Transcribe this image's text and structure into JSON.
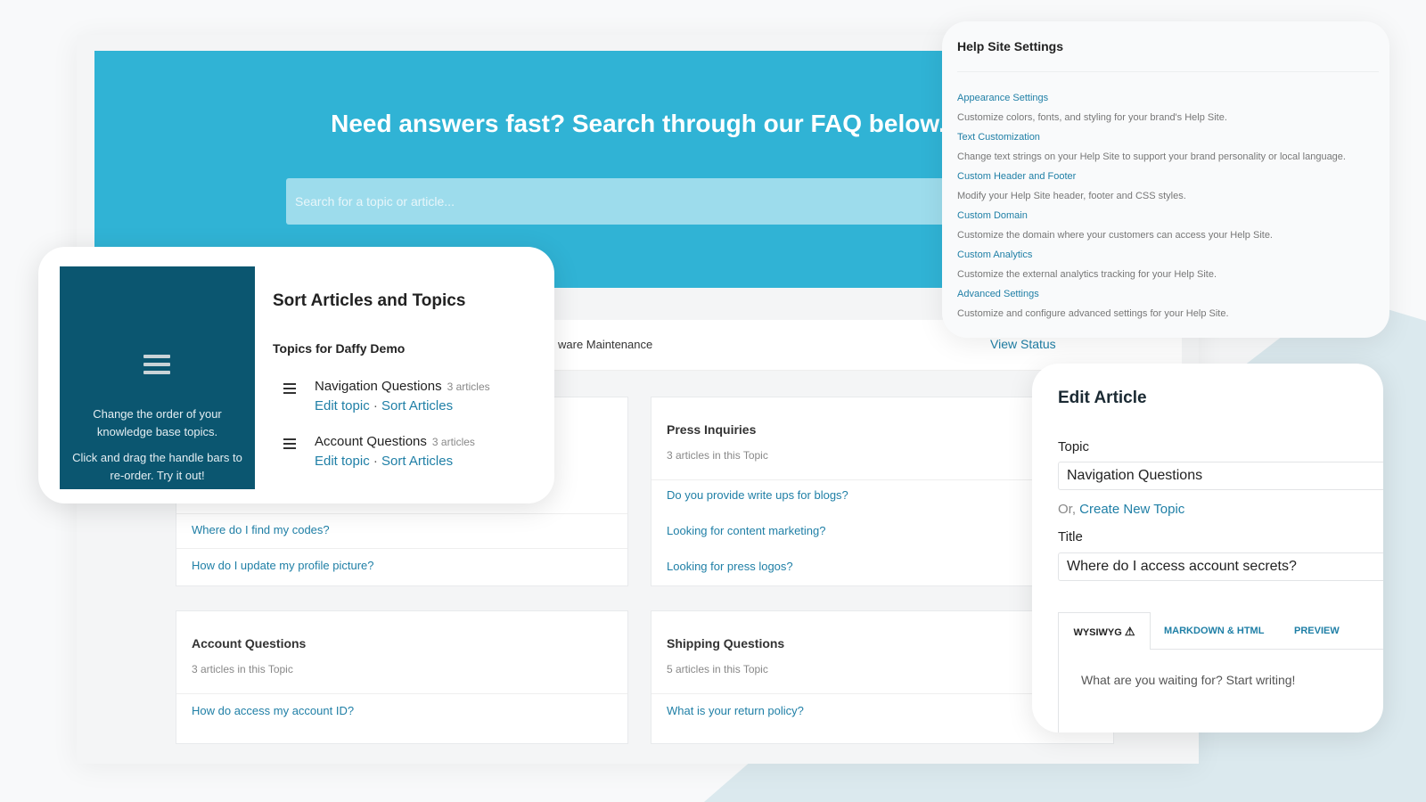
{
  "banner": {
    "heading": "Need answers fast? Search through our FAQ below.",
    "search_placeholder": "Search for a topic or article..."
  },
  "status_bar": {
    "text": "ware Maintenance",
    "link": "View Status"
  },
  "cards": [
    {
      "title": "",
      "count": "",
      "links": [
        "Where do I find my codes?",
        "How do I update my profile picture?"
      ]
    },
    {
      "title": "Press Inquiries",
      "count": "3 articles in this Topic",
      "links": [
        "Do you provide write ups for blogs?",
        "Looking for content marketing?",
        "Looking for press logos?"
      ]
    },
    {
      "title": "Account Questions",
      "count": "3 articles in this Topic",
      "links": [
        "How do access my account ID?"
      ]
    },
    {
      "title": "Shipping Questions",
      "count": "5 articles in this Topic",
      "links": [
        "What is your return policy?"
      ]
    }
  ],
  "sort_panel": {
    "tip1": "Change the order of your knowledge base topics.",
    "tip2": "Click and drag the handle bars to re-order. Try it out!",
    "title": "Sort Articles and Topics",
    "subtitle": "Topics for Daffy Demo",
    "topics": [
      {
        "name": "Navigation Questions",
        "count": "3 articles",
        "edit": "Edit topic",
        "sep": " · ",
        "sort": "Sort Articles"
      },
      {
        "name": "Account Questions",
        "count": "3 articles",
        "edit": "Edit topic",
        "sep": " · ",
        "sort": "Sort Articles"
      }
    ]
  },
  "settings": {
    "title": "Help Site Settings",
    "items": [
      {
        "label": "Appearance Settings",
        "desc": "Customize colors, fonts, and styling for your brand's Help Site."
      },
      {
        "label": "Text Customization",
        "desc": "Change text strings on your Help Site to support your brand personality or local language."
      },
      {
        "label": "Custom Header and Footer",
        "desc": "Modify your Help Site header, footer and CSS styles."
      },
      {
        "label": "Custom Domain",
        "desc": "Customize the domain where your customers can access your Help Site."
      },
      {
        "label": "Custom Analytics",
        "desc": "Customize the external analytics tracking for your Help Site."
      },
      {
        "label": "Advanced Settings",
        "desc": "Customize and configure advanced settings for your Help Site."
      }
    ]
  },
  "edit_article": {
    "title": "Edit Article",
    "topic_label": "Topic",
    "topic_value": "Navigation Questions",
    "or_text": "Or, ",
    "create_link": "Create New Topic",
    "title_label": "Title",
    "title_value": "Where do I access account secrets?",
    "tabs": [
      "WYSIWYG",
      "MARKDOWN & HTML",
      "PREVIEW"
    ],
    "warning_icon": "warning-icon",
    "editor_placeholder": "What are you waiting for? Start writing!"
  },
  "colors": {
    "accent": "#30b3d5",
    "link": "#1f7fa6",
    "dark_panel": "#0b5670"
  }
}
